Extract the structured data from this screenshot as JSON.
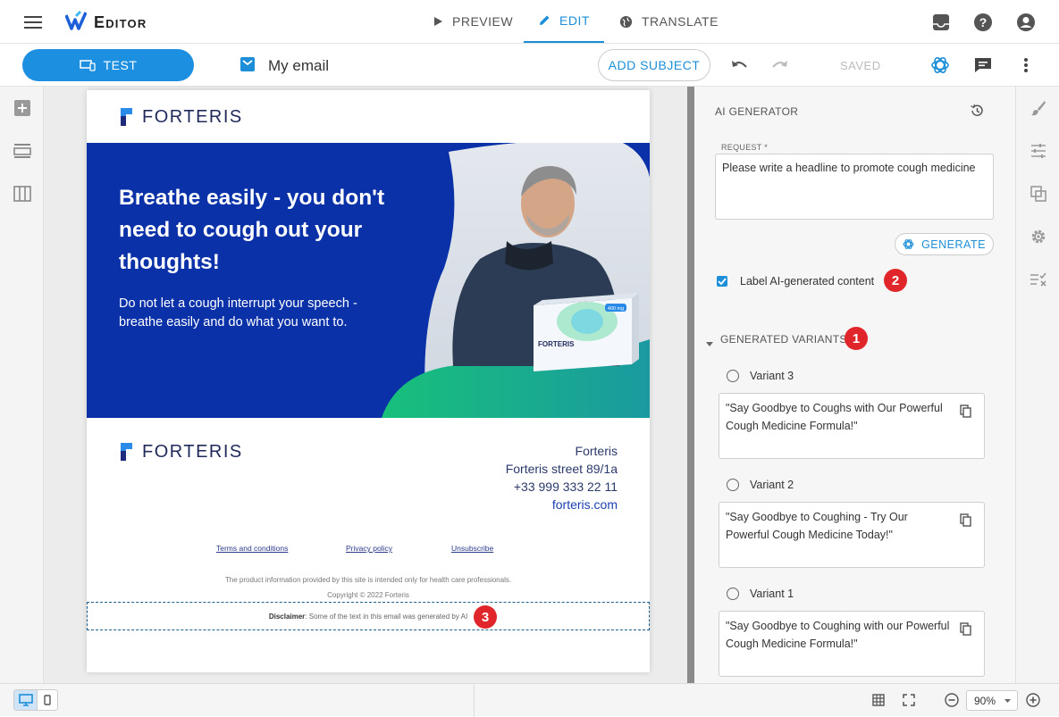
{
  "app": {
    "title": "Editor"
  },
  "nav": {
    "tabs": [
      {
        "label": "PREVIEW"
      },
      {
        "label": "EDIT"
      },
      {
        "label": "TRANSLATE"
      }
    ]
  },
  "toolbar": {
    "test_label": "TEST",
    "email_name": "My email",
    "add_subject_label": "ADD SUBJECT",
    "status": "SAVED"
  },
  "email": {
    "brand": "FORTERIS",
    "hero_title": "Breathe easily - you don't need to cough out your thoughts!",
    "hero_sub": "Do not let a cough interrupt your speech - breathe easily and do what you want to.",
    "product_box": {
      "name": "FORTERIS",
      "dose": "400 mg"
    },
    "footer_brand": "FORTERIS",
    "address": [
      "Forteris",
      "Forteris street 89/1a",
      "+33 999 333 22 11",
      "forteris.com"
    ],
    "links": [
      "Terms and conditions",
      "Privacy policy",
      "Unsubscribe"
    ],
    "note": "The product information provided by this site is intended only for health care professionals.",
    "copyright": "Copyright © 2022 Forteris",
    "disclaimer_bold": "Disclaimer",
    "disclaimer_text": ": Some of the text in this email was generated by AI"
  },
  "panel": {
    "title": "AI GENERATOR",
    "request_label": "REQUEST *",
    "request_value": "Please write a headline to promote cough medicine",
    "generate_label": "GENERATE",
    "checkbox_label": "Label AI-generated content",
    "checkbox_checked": true,
    "variants_header": "GENERATED VARIANTS",
    "variants": [
      {
        "label": "Variant 3",
        "text": "\"Say Goodbye to Coughs with Our Powerful Cough Medicine Formula!\""
      },
      {
        "label": "Variant 2",
        "text": "\"Say Goodbye to Coughing - Try Our Powerful Cough Medicine Today!\""
      },
      {
        "label": "Variant 1",
        "text": "\"Say Goodbye to Coughing with our Powerful Cough Medicine Formula!\""
      }
    ]
  },
  "badges": [
    "1",
    "2",
    "3"
  ],
  "bottom": {
    "zoom": "90%"
  },
  "colors": {
    "accent": "#1d8fd8",
    "hero": "#0a31a8",
    "badge": "#e0262a",
    "green": "#18c07a"
  }
}
